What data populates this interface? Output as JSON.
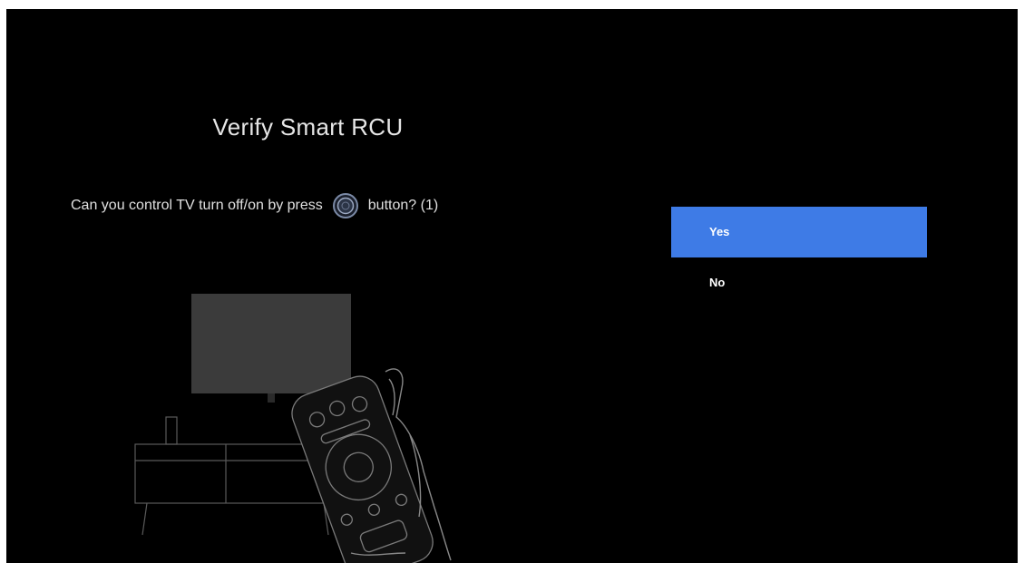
{
  "page": {
    "title": "Verify Smart RCU",
    "question_before": "Can you control TV turn off/on by press",
    "question_after": "button? (1)"
  },
  "icons": {
    "inline_button": "power-button-icon",
    "illustration": "tv-and-remote-illustration"
  },
  "options": [
    {
      "label": "Yes",
      "selected": true
    },
    {
      "label": "No",
      "selected": false
    }
  ],
  "colors": {
    "background": "#000000",
    "selected_option": "#3e7be6",
    "text": "#e6e6e6"
  }
}
